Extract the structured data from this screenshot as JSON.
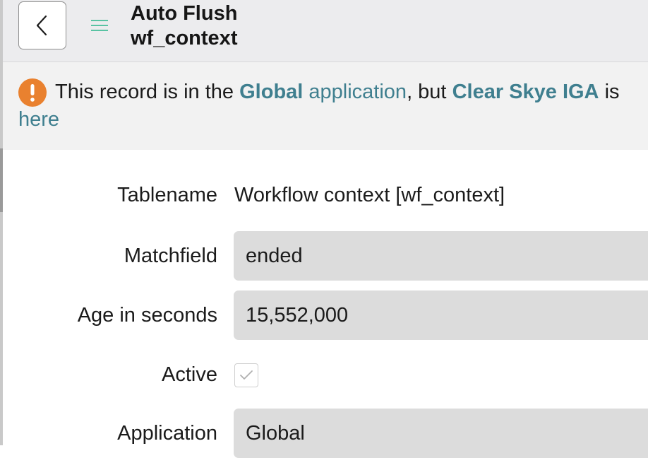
{
  "header": {
    "title": "Auto Flush",
    "subtitle": "wf_context"
  },
  "banner": {
    "text_1": "This record is in the ",
    "app_name": "Global",
    "app_word": " application",
    "text_2": ", but ",
    "scope_name": "Clear Skye IGA",
    "text_3": " is",
    "link_here": "here"
  },
  "form": {
    "tablename": {
      "label": "Tablename",
      "value": "Workflow context [wf_context]"
    },
    "matchfield": {
      "label": "Matchfield",
      "value": "ended"
    },
    "age": {
      "label": "Age in seconds",
      "value": "15,552,000"
    },
    "active": {
      "label": "Active",
      "checked": true
    },
    "application": {
      "label": "Application",
      "value": "Global"
    }
  },
  "icons": {
    "back": "chevron-left-icon",
    "menu": "hamburger-menu-icon",
    "warning": "exclamation-circle-icon",
    "check": "checkmark-icon"
  },
  "colors": {
    "warning": "#e9812f",
    "link": "#3f7f8f",
    "menu": "#59c3a3"
  }
}
